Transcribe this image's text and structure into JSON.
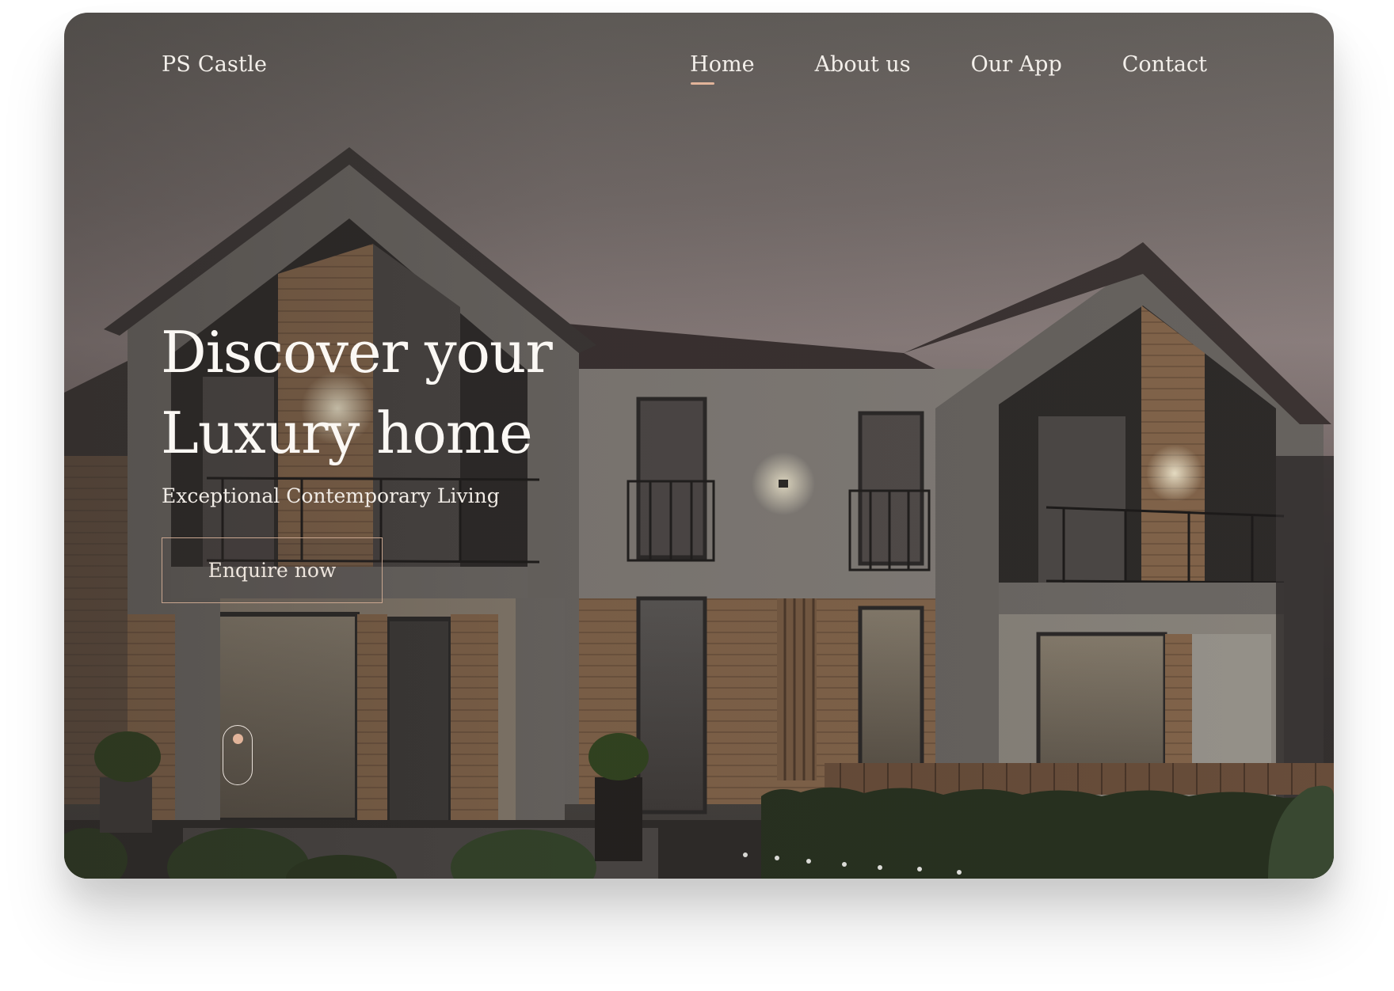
{
  "brand": {
    "name": "PS Castle"
  },
  "nav": {
    "items": [
      {
        "label": "Home",
        "active": true
      },
      {
        "label": "About us",
        "active": false
      },
      {
        "label": "Our App",
        "active": false
      },
      {
        "label": "Contact",
        "active": false
      }
    ]
  },
  "hero": {
    "title_line1": "Discover your",
    "title_line2": "Luxury home",
    "subtitle": "Exceptional Contemporary Living",
    "cta_label": "Enquire now"
  },
  "colors": {
    "accent": "#e2b49a",
    "text": "#f3efea"
  },
  "icons": {
    "scroll": "scroll-mouse-icon"
  }
}
